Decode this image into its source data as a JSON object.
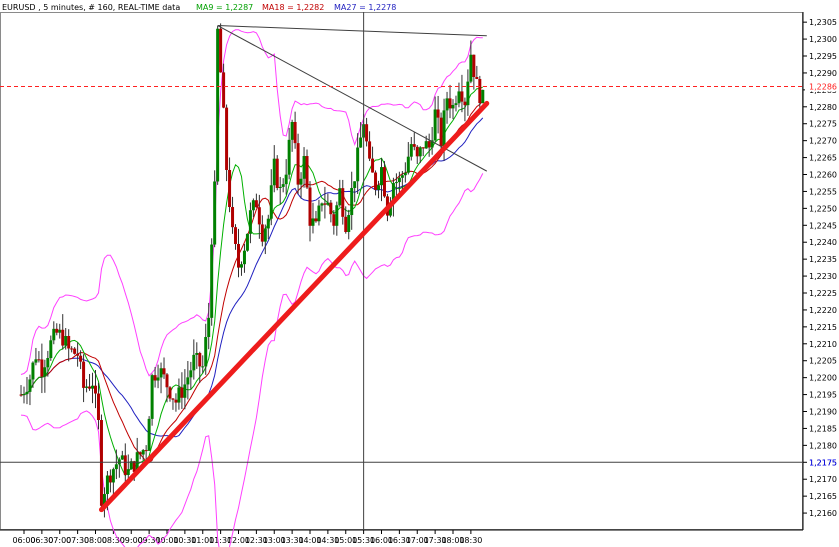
{
  "header": {
    "title": "EURUSD , 5 minutes, # 160, REAL-TIME data",
    "ma9": "MA9 = 1,2287",
    "ma18": "MA18 = 1,2282",
    "ma27": "MA27 = 1,2278"
  },
  "colors": {
    "background": "#ffffff",
    "up_candle": "#008000",
    "down_candle": "#b00000",
    "ma9": "#00b000",
    "ma18": "#c00000",
    "ma27": "#2020c0",
    "bollinger": "#ff40ff",
    "trendline": "#ee1c1c",
    "triangle": "#404040",
    "crosshair": "#404040",
    "current_price": "#ff2020"
  },
  "chart_data": {
    "type": "candlestick",
    "instrument": "EURUSD",
    "timeframe": "5 minutes",
    "x_labels": [
      "06:00",
      "06:30",
      "07:00",
      "07:30",
      "08:00",
      "08:30",
      "09:00",
      "09:30",
      "10:00",
      "10:30",
      "11:00",
      "11:30",
      "12:00",
      "12:30",
      "13:00",
      "13:30",
      "14:00",
      "14:30",
      "15:00",
      "15:30",
      "16:00",
      "16:30",
      "17:00",
      "17:30",
      "18:00",
      "18:30"
    ],
    "y_ticks": [
      "1,2305",
      "1,2300",
      "1,2295",
      "1,2290",
      "1,2285",
      "1,2280",
      "1,2275",
      "1,2270",
      "1,2265",
      "1,2260",
      "1,2255",
      "1,2250",
      "1,2245",
      "1,2240",
      "1,2235",
      "1,2230",
      "1,2225",
      "1,2220",
      "1,2215",
      "1,2210",
      "1,2205",
      "1,2200",
      "1,2195",
      "1,2190",
      "1,2185",
      "1,2180",
      "1,2175",
      "1,2170",
      "1,2165",
      "1,2160"
    ],
    "ylim": [
      1.2155,
      1.2308
    ],
    "current_price": 1.2286,
    "current_price_label": "1,2286",
    "crosshair_price": 1.2175,
    "crosshair_price_label": "1,2175",
    "crosshair_time": "15:30",
    "grid": false,
    "moving_averages": [
      {
        "name": "MA9",
        "period": 9,
        "last": 1.2287
      },
      {
        "name": "MA18",
        "period": 18,
        "last": 1.2282
      },
      {
        "name": "MA27",
        "period": 27,
        "last": 1.2278
      }
    ],
    "trendline_support": [
      {
        "time": "08:10",
        "price": 1.2161
      },
      {
        "time": "18:50",
        "price": 1.2281
      }
    ],
    "triangle_upper": [
      {
        "time": "11:25",
        "price": 1.2304
      },
      {
        "time": "18:50",
        "price": 1.2301
      }
    ],
    "triangle_lower": [
      {
        "time": "11:25",
        "price": 1.2304
      },
      {
        "time": "18:50",
        "price": 1.2261
      }
    ],
    "close_anchors": [
      [
        "05:55",
        1.2195
      ],
      [
        "06:10",
        1.22
      ],
      [
        "06:20",
        1.2207
      ],
      [
        "06:30",
        1.2203
      ],
      [
        "06:45",
        1.221
      ],
      [
        "06:55",
        1.2213
      ],
      [
        "07:05",
        1.2212
      ],
      [
        "07:15",
        1.2208
      ],
      [
        "07:30",
        1.2207
      ],
      [
        "07:40",
        1.2197
      ],
      [
        "07:55",
        1.2199
      ],
      [
        "08:05",
        1.2186
      ],
      [
        "08:10",
        1.2165
      ],
      [
        "08:25",
        1.2172
      ],
      [
        "08:40",
        1.2176
      ],
      [
        "08:55",
        1.2172
      ],
      [
        "09:10",
        1.2176
      ],
      [
        "09:25",
        1.218
      ],
      [
        "09:35",
        1.22
      ],
      [
        "09:45",
        1.2203
      ],
      [
        "10:00",
        1.2198
      ],
      [
        "10:15",
        1.2193
      ],
      [
        "10:30",
        1.2198
      ],
      [
        "10:45",
        1.2205
      ],
      [
        "11:00",
        1.2203
      ],
      [
        "11:10",
        1.2218
      ],
      [
        "11:15",
        1.2242
      ],
      [
        "11:20",
        1.2255
      ],
      [
        "11:25",
        1.2302
      ],
      [
        "11:30",
        1.229
      ],
      [
        "11:35",
        1.2277
      ],
      [
        "11:40",
        1.2262
      ],
      [
        "11:50",
        1.2242
      ],
      [
        "12:00",
        1.2233
      ],
      [
        "12:10",
        1.2239
      ],
      [
        "12:20",
        1.2248
      ],
      [
        "12:30",
        1.2252
      ],
      [
        "12:40",
        1.2243
      ],
      [
        "12:50",
        1.2247
      ],
      [
        "13:00",
        1.2262
      ],
      [
        "13:10",
        1.2255
      ],
      [
        "13:20",
        1.2262
      ],
      [
        "13:30",
        1.2275
      ],
      [
        "13:40",
        1.2258
      ],
      [
        "13:50",
        1.2264
      ],
      [
        "14:00",
        1.2247
      ],
      [
        "14:10",
        1.2244
      ],
      [
        "14:20",
        1.2253
      ],
      [
        "14:30",
        1.2251
      ],
      [
        "14:40",
        1.2246
      ],
      [
        "14:50",
        1.2255
      ],
      [
        "15:00",
        1.2246
      ],
      [
        "15:10",
        1.2255
      ],
      [
        "15:20",
        1.2265
      ],
      [
        "15:30",
        1.2276
      ],
      [
        "15:40",
        1.2262
      ],
      [
        "15:50",
        1.2257
      ],
      [
        "16:00",
        1.2262
      ],
      [
        "16:10",
        1.225
      ],
      [
        "16:20",
        1.2258
      ],
      [
        "16:30",
        1.2258
      ],
      [
        "16:40",
        1.2262
      ],
      [
        "16:50",
        1.2269
      ],
      [
        "17:00",
        1.2264
      ],
      [
        "17:10",
        1.2269
      ],
      [
        "17:20",
        1.2268
      ],
      [
        "17:30",
        1.2278
      ],
      [
        "17:40",
        1.227
      ],
      [
        "17:50",
        1.2283
      ],
      [
        "18:00",
        1.228
      ],
      [
        "18:10",
        1.2287
      ],
      [
        "18:20",
        1.2282
      ],
      [
        "18:30",
        1.2296
      ],
      [
        "18:40",
        1.2286
      ],
      [
        "18:50",
        1.2282
      ]
    ]
  }
}
